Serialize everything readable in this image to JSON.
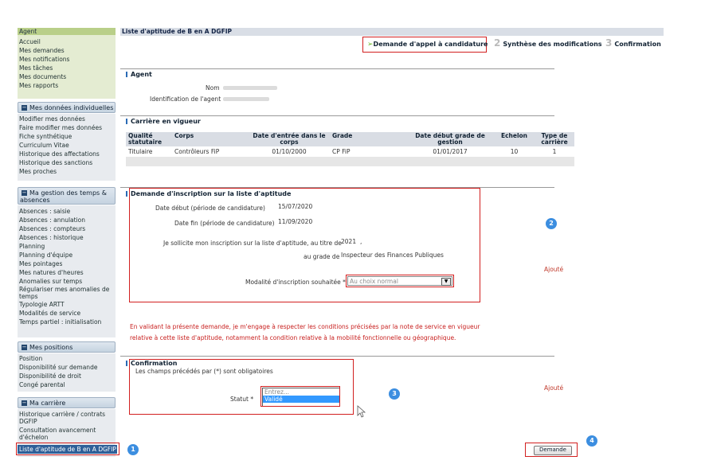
{
  "sidebar": {
    "agent_header": "Agent",
    "agent_items": [
      "Accueil",
      "Mes demandes",
      "Mes notifications",
      "Mes tâches",
      "Mes documents",
      "Mes rapports"
    ],
    "section1_title": "Mes données individuelles",
    "section1_items": [
      "Modifier mes données",
      "Faire modifier mes données",
      "Fiche synthétique",
      "Curriculum Vitae",
      "Historique des affectations",
      "Historique des sanctions",
      "Mes proches"
    ],
    "section2_title": "Ma gestion des temps & absences",
    "section2_items": [
      "Absences : saisie",
      "Absences : annulation",
      "Absences : compteurs",
      "Absences : historique",
      "Planning",
      "Planning d'équipe",
      "Mes pointages",
      "Mes natures d'heures",
      "Anomalies sur temps",
      "Régulariser mes anomalies de temps",
      "Typologie ARTT",
      "Modalités de service",
      "Temps partiel : initialisation"
    ],
    "section3_title": "Mes positions",
    "section3_items": [
      "Position",
      "Disponibilité sur demande",
      "Disponibilité de droit",
      "Congé parental"
    ],
    "section4_title": "Ma carrière",
    "section4_items": [
      "Historique carrière / contrats DGFIP",
      "Consultation avancement d'échelon",
      "Liste d'aptitude de B en A DGFIP"
    ]
  },
  "main": {
    "title": "Liste d'aptitude de B en A DGFIP",
    "steps": [
      {
        "num": "",
        "label": "Demande d'appel à candidature"
      },
      {
        "num": "2",
        "label": "Synthèse des modifications"
      },
      {
        "num": "3",
        "label": "Confirmation"
      }
    ],
    "agent_section": "Agent",
    "nom_label": "Nom",
    "ident_label": "Identification de l'agent",
    "carriere_section": "Carrière en vigueur",
    "table_headers": [
      "Qualité statutaire",
      "Corps",
      "Date d'entrée dans le corps",
      "Grade",
      "Date début grade de gestion",
      "Echelon",
      "Type de carrière"
    ],
    "table_row": [
      "Titulaire",
      "Contrôleurs FiP",
      "01/10/2000",
      "CP FiP",
      "01/01/2017",
      "10",
      "1"
    ],
    "demande_section": "Demande d'inscription sur la liste d'aptitude",
    "date_debut_label": "Date début (période de candidature)",
    "date_debut_value": "15/07/2020",
    "date_fin_label": "Date fin (période de candidature)",
    "date_fin_value": "11/09/2020",
    "sollicite_label": "Je sollicite mon inscription sur la liste d'aptitude, au titre de",
    "sollicite_value": "2021",
    "sollicite_suffix": ",",
    "grade_label": "au grade de",
    "grade_value": "Inspecteur des Finances Publiques",
    "modalite_label": "Modalité d'inscription souhaitée *",
    "modalite_value": "Au choix normal",
    "ajoute1": "Ajouté",
    "warning_line1": "En validant la présente demande, je m'engage à respecter les conditions précisées par la note de service en vigueur",
    "warning_line2": "relative à cette liste d'aptitude, notamment la condition relative à la mobilité fonctionnelle ou géographique.",
    "confirmation_section": "Confirmation",
    "required_note": "Les champs précédés par (*) sont obligatoires",
    "statut_label": "Statut *",
    "statut_options": [
      "Entrez...",
      "Validé"
    ],
    "ajoute2": "Ajouté",
    "demande_button": "Demande"
  },
  "annotations": [
    "1",
    "2",
    "3",
    "4"
  ],
  "colors": {
    "accent_red": "#d21f1f",
    "annotation_blue": "#3c8ee0",
    "agent_green": "#b9cf89"
  }
}
